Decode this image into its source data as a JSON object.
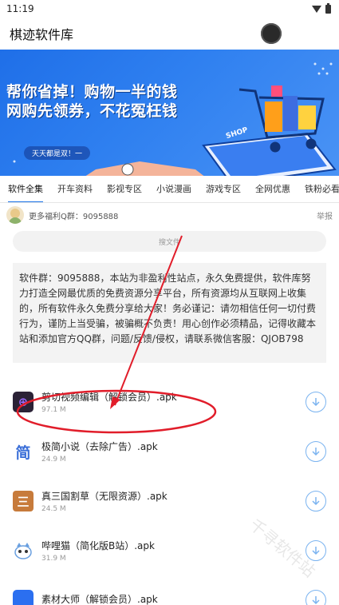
{
  "status": {
    "time": "11:19"
  },
  "appbar": {
    "title": "棋迹软件库"
  },
  "banner": {
    "line1": "帮你省掉！购物一半的钱",
    "line2": "网购先领券，不花冤枉钱",
    "subtitle": "天天都是双！一",
    "shop_label": "SHOP"
  },
  "tabs": [
    "软件全集",
    "开车资料",
    "影视专区",
    "小说漫画",
    "游戏专区",
    "全网优惠",
    "铁粉必看"
  ],
  "notice": {
    "text": "更多福利Q群：9095888",
    "report": "举报"
  },
  "search": {
    "placeholder": "搜文件"
  },
  "info": "软件群：9095888，本站为非盈利性站点，永久免费提供，软件库努力打造全网最优质的免费资源分享平台，所有资源均从互联网上收集的，所有软件永久免费分享给大家！务必谨记：请勿相信任何一切付费行为，谨防上当受骗，被骗概不负责！用心创作必须精品，记得收藏本站和添加官方QQ群，问题/反馈/侵权，请联系微信客服：QJOB798",
  "apps": [
    {
      "name": "剪切视频编辑（解锁会员）.apk",
      "size": "97.1 M",
      "icon": "jianqie-icon",
      "glyph": "⊕"
    },
    {
      "name": "极简小说（去除广告）.apk",
      "size": "24.9 M",
      "icon": "jianjian-icon",
      "glyph": "简"
    },
    {
      "name": "真三国割草（无限资源）.apk",
      "size": "24.5 M",
      "icon": "sanguo-icon",
      "glyph": "三"
    },
    {
      "name": "哔哩猫（简化版B站）.apk",
      "size": "31.9 M",
      "icon": "bilimao-icon",
      "glyph": ""
    },
    {
      "name": "素材大师（解锁会员）.apk",
      "size": "",
      "icon": "sucai-icon",
      "glyph": ""
    }
  ],
  "watermark": "千寻软件站",
  "colors": {
    "accent": "#1a73e8",
    "annotation": "#e11d2a"
  }
}
